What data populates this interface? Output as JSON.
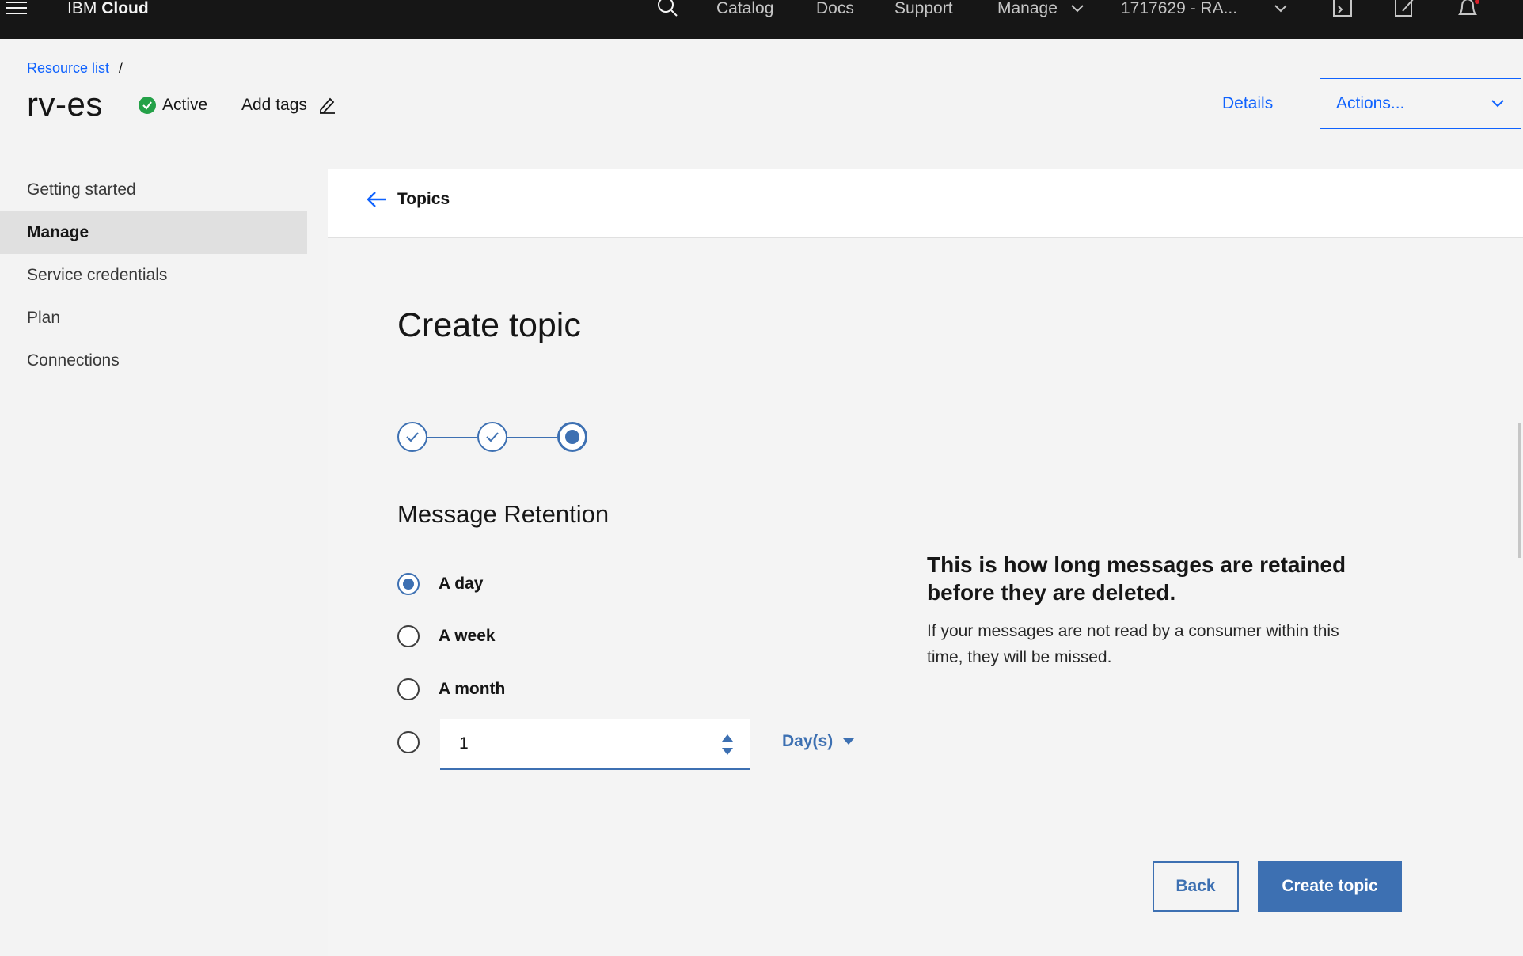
{
  "topbar": {
    "brand_ibm": "IBM",
    "brand_cloud": "Cloud",
    "nav": {
      "catalog": "Catalog",
      "docs": "Docs",
      "support": "Support",
      "manage": "Manage",
      "account": "1717629 - RA..."
    }
  },
  "breadcrumb": {
    "link": "Resource list",
    "separator": "/"
  },
  "header": {
    "title": "rv-es",
    "status": "Active",
    "add_tags": "Add tags",
    "details": "Details",
    "actions": "Actions..."
  },
  "sidebar": {
    "items": [
      {
        "label": "Getting started"
      },
      {
        "label": "Manage"
      },
      {
        "label": "Service credentials"
      },
      {
        "label": "Plan"
      },
      {
        "label": "Connections"
      }
    ]
  },
  "panel": {
    "back_label": "Topics",
    "title": "Create topic",
    "section_title": "Message Retention",
    "options": [
      {
        "label": "A day"
      },
      {
        "label": "A week"
      },
      {
        "label": "A month"
      }
    ],
    "custom_value": "1",
    "unit": "Day(s)",
    "help_title": "This is how long messages are retained before they are deleted.",
    "help_text": "If your messages are not read by a consumer within this time, they will be missed.",
    "back_button": "Back",
    "create_button": "Create topic"
  },
  "colors": {
    "accent": "#3d70b2",
    "link": "#0f62fe",
    "status_green": "#24a148",
    "topbar": "#161616"
  }
}
